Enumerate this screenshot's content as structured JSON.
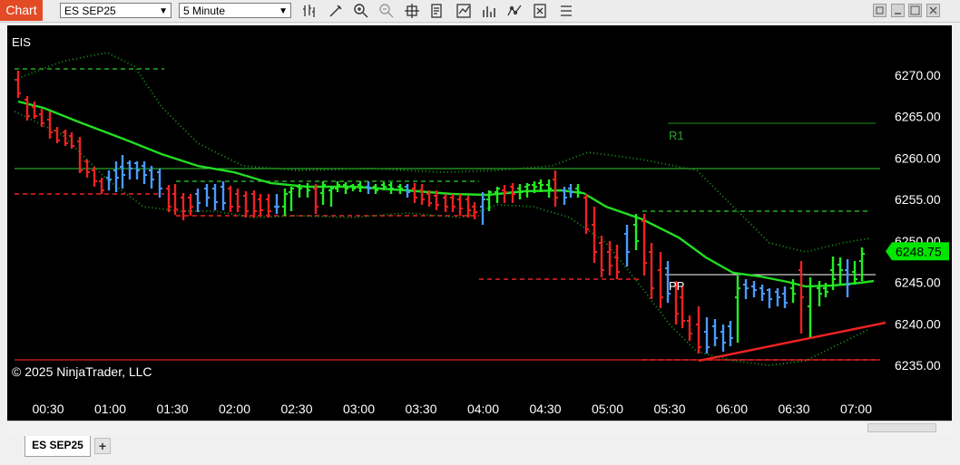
{
  "toolbar": {
    "chart_label": "Chart",
    "instrument_select": "ES SEP25",
    "interval_select": "5 Minute",
    "icons": [
      "bar-type-icon",
      "drawing-tools-icon",
      "zoom-in-icon",
      "zoom-out-icon",
      "crosshair-icon",
      "data-box-icon",
      "indicators-icon",
      "strategies-icon",
      "templates-icon",
      "properties-icon",
      "more-icon"
    ]
  },
  "window_buttons": [
    "restore-icon",
    "minimize-icon",
    "maximize-icon",
    "close-icon"
  ],
  "chart": {
    "instrument_label": "EIS",
    "copyright": "© 2025 NinjaTrader, LLC",
    "price_labels": [
      "6270.00",
      "6265.00",
      "6260.00",
      "6255.00",
      "6250.00",
      "6245.00",
      "6240.00",
      "6235.00"
    ],
    "current_price": "6248.75",
    "current_price_color": "#00e600",
    "time_labels": [
      "00:30",
      "01:00",
      "01:30",
      "02:00",
      "02:30",
      "03:00",
      "03:30",
      "04:00",
      "04:30",
      "05:00",
      "05:30",
      "06:00",
      "06:30",
      "07:00"
    ],
    "level_labels": {
      "r1": "R1",
      "pp": "PP"
    },
    "colors": {
      "up": "#22ee22",
      "down": "#ee2222",
      "neutral": "#4a9aff",
      "ma": "#22dd22",
      "pivot": "#ffffff"
    }
  },
  "tabs": {
    "active": "ES SEP25",
    "add_label": "+"
  }
}
